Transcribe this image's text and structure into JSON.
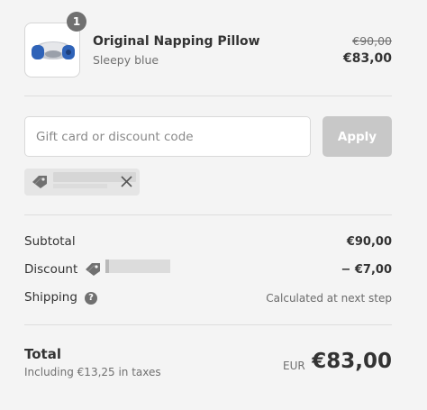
{
  "product": {
    "quantity": "1",
    "name": "Original Napping Pillow",
    "variant": "Sleepy blue",
    "original_price": "€90,00",
    "price": "€83,00",
    "image_icon": "pillow-product-image"
  },
  "discount_form": {
    "placeholder": "Gift card or discount code",
    "value": "",
    "apply_label": "Apply"
  },
  "applied_code": {
    "icon": "tag-icon",
    "remove_icon": "close-icon"
  },
  "summary": {
    "subtotal_label": "Subtotal",
    "subtotal_value": "€90,00",
    "discount_label": "Discount",
    "discount_value": "− €7,00",
    "shipping_label": "Shipping",
    "shipping_help": "?",
    "shipping_value": "Calculated at next step"
  },
  "total": {
    "label": "Total",
    "tax_note": "Including €13,25 in taxes",
    "currency": "EUR",
    "amount": "€83,00"
  },
  "colors": {
    "background": "#f4f4f4",
    "text": "#333333",
    "muted": "#707070",
    "button_disabled": "#c8c8c8",
    "product_blue": "#2f63b8"
  }
}
